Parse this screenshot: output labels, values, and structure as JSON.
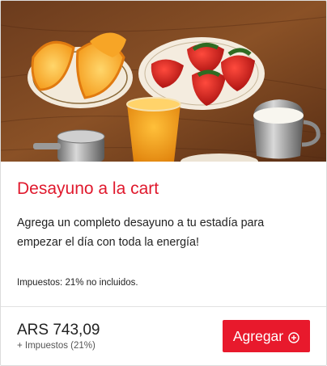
{
  "card": {
    "image_alt": "breakfast-photo",
    "title": "Desayuno a la cart",
    "description": "Agrega un completo desayuno a tu estadía para empezar el día con toda la energía!",
    "tax_note": "Impuestos: 21% no incluidos.",
    "price": "ARS 743,09",
    "price_sub": "+ Impuestos (21%)",
    "add_button_label": "Agregar",
    "add_icon": "plus-circle-icon"
  },
  "colors": {
    "accent": "#e8192c",
    "title": "#e0192d"
  }
}
